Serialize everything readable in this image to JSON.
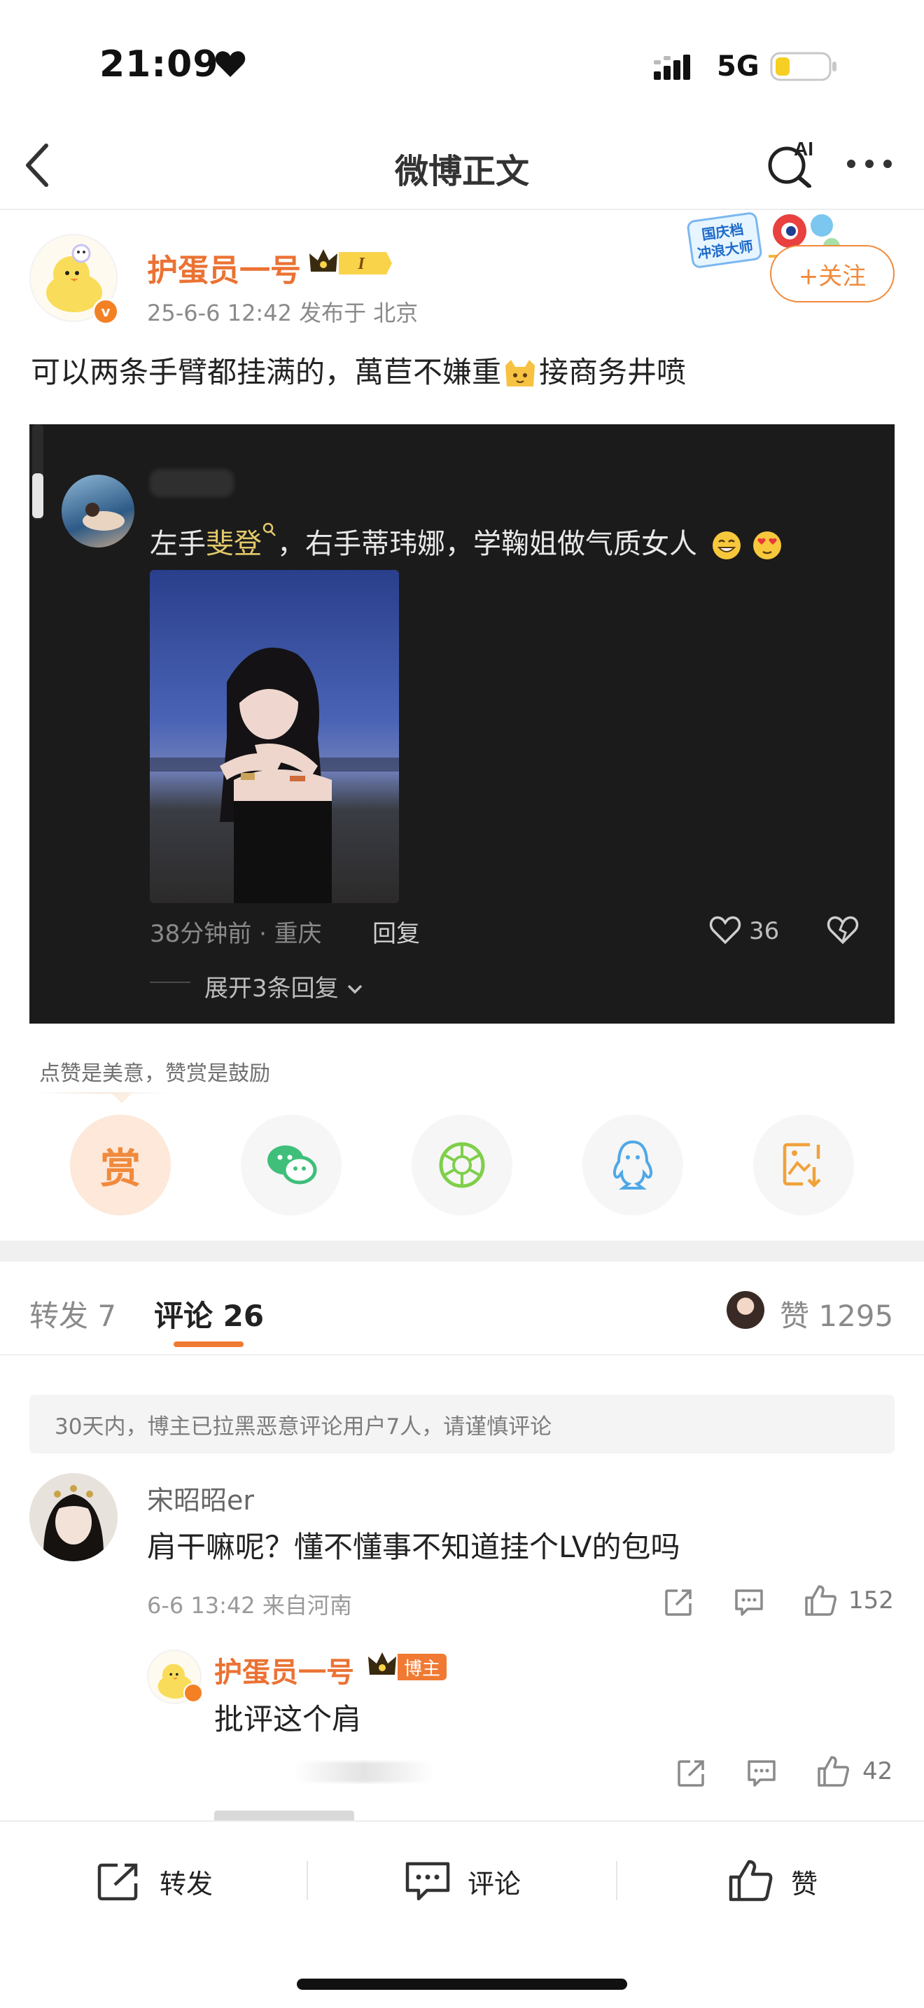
{
  "status_bar": {
    "time": "21:09",
    "network": "5G",
    "icons": [
      "heart-icon",
      "signal-icon",
      "battery-icon"
    ]
  },
  "nav": {
    "title": "微博正文",
    "ai_label": "AI",
    "icons": [
      "back-icon",
      "ai-search-icon",
      "more-icon"
    ]
  },
  "post": {
    "author_name": "护蛋员一号",
    "crown_level": "I",
    "meta": "25-6-6 12:42  发布于 北京",
    "follow_label": "+关注",
    "banner_text": [
      "国庆档",
      "冲浪大师"
    ],
    "text_before": "可以两条手臂都挂满的，萬苣不嫌重",
    "text_after": "接商务井喷"
  },
  "embed": {
    "text_prefix": "左手",
    "highlight": "斐登",
    "text_suffix": "，右手蒂玮娜，学鞠姐做气质女人",
    "time": "38分钟前 · 重庆",
    "reply_label": "回复",
    "like_count": "36",
    "expand_label": "展开3条回复"
  },
  "reward": {
    "tip": "点赞是美意，赞赏是鼓励",
    "reward_label": "赏"
  },
  "share_targets": [
    "wechat-icon",
    "moments-icon",
    "qq-icon",
    "save-image-icon"
  ],
  "tabs": {
    "repost": "转发 7",
    "comment": "评论 26",
    "likes": "赞 1295"
  },
  "notice": "30天内，博主已拉黑恶意评论用户7人，请谨慎评论",
  "comment": {
    "name": "宋昭昭er",
    "text": "肩干嘛呢？懂不懂事不知道挂个LV的包吗",
    "meta": "6-6 13:42  来自河南",
    "like_count": "152",
    "reply": {
      "name": "护蛋员一号",
      "tag": "博主",
      "text": "批评这个肩",
      "like_count": "42"
    }
  },
  "bottom_bar": {
    "repost": "转发",
    "comment": "评论",
    "like": "赞"
  },
  "colors": {
    "accent": "#eb7233",
    "follow": "#f08a3c",
    "highlight": "#e3c96b",
    "dark_bg": "#1b1b1b"
  }
}
